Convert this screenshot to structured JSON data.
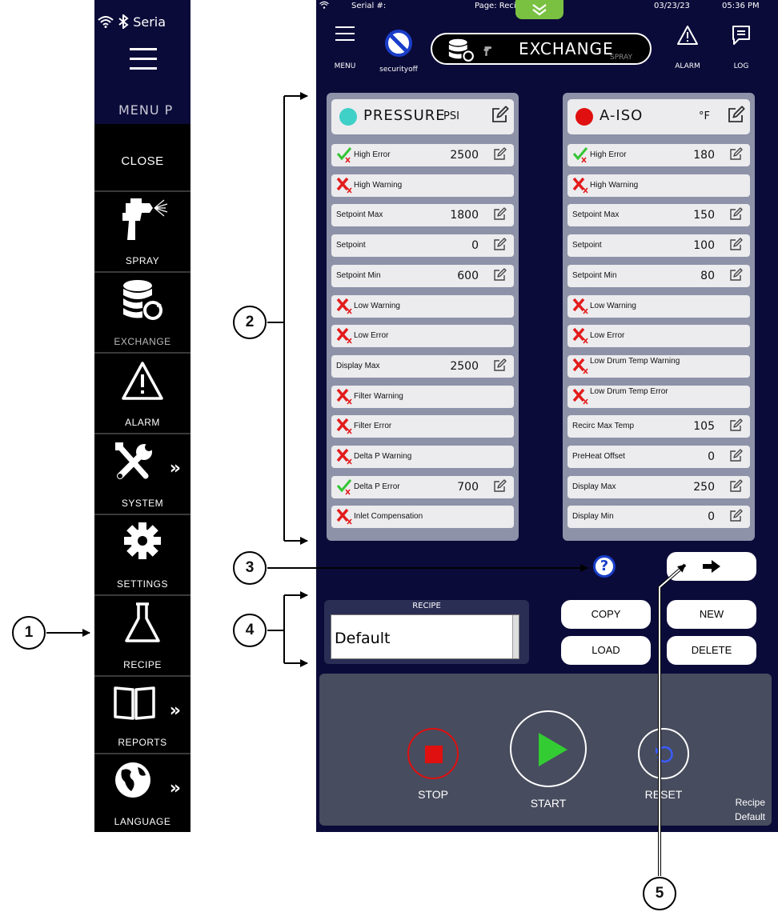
{
  "sidemenu": {
    "status_text": "Seria",
    "menu_label": "MENU  P",
    "items": [
      {
        "label": "CLOSE",
        "icon": "close"
      },
      {
        "label": "SPRAY",
        "icon": "spray-gun-icon"
      },
      {
        "label": "EXCHANGE",
        "icon": "database-sync-icon"
      },
      {
        "label": "ALARM",
        "icon": "warning-triangle-icon"
      },
      {
        "label": "SYSTEM",
        "icon": "tools-icon",
        "chevron": "»"
      },
      {
        "label": "SETTINGS",
        "icon": "gear-icon"
      },
      {
        "label": "RECIPE",
        "icon": "flask-icon"
      },
      {
        "label": "REPORTS",
        "icon": "book-icon",
        "chevron": "»"
      },
      {
        "label": "LANGUAGE",
        "icon": "globe-icon",
        "chevron": "»"
      }
    ]
  },
  "screen": {
    "topbar": {
      "serial": "Serial #:",
      "page": "Page: Recipe",
      "date": "03/23/23",
      "time": "05:36 PM"
    },
    "header": {
      "menu_label": "MENU",
      "security_label": "securityoff",
      "title": "EXCHANGE",
      "subtitle": "SPRAY",
      "alarm_label": "ALARM",
      "log_label": "LOG"
    },
    "pressure_panel": {
      "name": "PRESSURE",
      "unit": "PSI",
      "dot_color": "#3fd0c8",
      "rows": [
        {
          "label": "High Error",
          "value": "2500",
          "status": "check",
          "editable": true
        },
        {
          "label": "High Warning",
          "value": "",
          "status": "x",
          "editable": false
        },
        {
          "label": "Setpoint Max",
          "value": "1800",
          "status": "none",
          "editable": true
        },
        {
          "label": "Setpoint",
          "value": "0",
          "status": "none",
          "editable": true
        },
        {
          "label": "Setpoint Min",
          "value": "600",
          "status": "none",
          "editable": true
        },
        {
          "label": "Low Warning",
          "value": "",
          "status": "x",
          "editable": false
        },
        {
          "label": "Low Error",
          "value": "",
          "status": "x",
          "editable": false
        },
        {
          "label": "Display Max",
          "value": "2500",
          "status": "none",
          "editable": true
        },
        {
          "label": "Filter Warning",
          "value": "",
          "status": "x",
          "editable": false
        },
        {
          "label": "Filter Error",
          "value": "",
          "status": "x",
          "editable": false
        },
        {
          "label": "Delta P Warning",
          "value": "",
          "status": "x",
          "editable": false
        },
        {
          "label": "Delta P Error",
          "value": "700",
          "status": "check",
          "editable": true
        },
        {
          "label": "Inlet Compensation",
          "value": "",
          "status": "x",
          "editable": false
        }
      ]
    },
    "iso_panel": {
      "name": "A-ISO",
      "unit": "°F",
      "dot_color": "#e01010",
      "rows": [
        {
          "label": "High Error",
          "value": "180",
          "status": "check",
          "editable": true
        },
        {
          "label": "High Warning",
          "value": "",
          "status": "x",
          "editable": false
        },
        {
          "label": "Setpoint Max",
          "value": "150",
          "status": "none",
          "editable": true
        },
        {
          "label": "Setpoint",
          "value": "100",
          "status": "none",
          "editable": true
        },
        {
          "label": "Setpoint Min",
          "value": "80",
          "status": "none",
          "editable": true
        },
        {
          "label": "Low Warning",
          "value": "",
          "status": "x",
          "editable": false
        },
        {
          "label": "Low Error",
          "value": "",
          "status": "x",
          "editable": false
        },
        {
          "label": "Low Drum Temp Warning",
          "value": "",
          "status": "x",
          "editable": false
        },
        {
          "label": "Low Drum Temp Error",
          "value": "",
          "status": "x",
          "editable": false
        },
        {
          "label": "Recirc Max Temp",
          "value": "105",
          "status": "none",
          "editable": true
        },
        {
          "label": "PreHeat Offset",
          "value": "0",
          "status": "none",
          "editable": true
        },
        {
          "label": "Display Max",
          "value": "250",
          "status": "none",
          "editable": true
        },
        {
          "label": "Display Min",
          "value": "0",
          "status": "none",
          "editable": true
        }
      ]
    },
    "help_label": "?",
    "next_label": "🡒",
    "recipe": {
      "caption": "RECIPE",
      "value": "Default"
    },
    "buttons": {
      "copy": "COPY",
      "new": "NEW",
      "load": "LOAD",
      "delete": "DELETE"
    },
    "controls": {
      "stop": "STOP",
      "start": "START",
      "reset": "RESET",
      "recipe_caption": "Recipe",
      "recipe_value": "Default"
    }
  },
  "callouts": [
    "1",
    "2",
    "3",
    "4",
    "5"
  ],
  "colors": {
    "screen_bg": "#0b0b3a",
    "panel_bg": "#8e92a8",
    "row_bg": "#ececee",
    "ok_green": "#34c534",
    "err_red": "#e31b1b",
    "start_green": "#33cc33",
    "stop_red": "#e01010"
  }
}
